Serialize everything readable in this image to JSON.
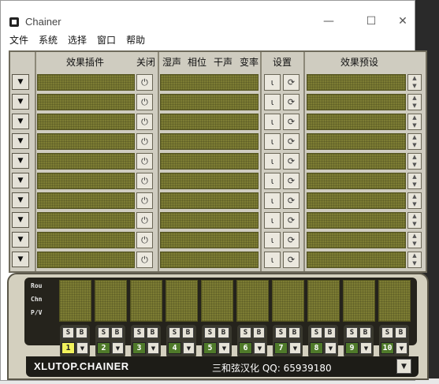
{
  "window": {
    "title": "Chainer",
    "min_glyph": "—",
    "max_glyph": "☐",
    "close_glyph": "✕"
  },
  "menu": [
    "文件",
    "系统",
    "选择",
    "窗口",
    "帮助"
  ],
  "header": {
    "plugin": "效果插件",
    "bypass": "关闭",
    "wet": "湿声",
    "phase": "相位",
    "dry": "干声",
    "rate": "变率",
    "settings": "设置",
    "preset": "效果预设"
  },
  "rows": 10,
  "glyphs": {
    "slot": "▼",
    "power": "⏻",
    "set1": "⍳",
    "set2": "⟳",
    "up": "▲",
    "down": "▼"
  },
  "mixer": {
    "labels": [
      "Rou",
      "Chn",
      "P/V"
    ],
    "btn_s": "S",
    "btn_b": "B",
    "channels": [
      "1",
      "2",
      "3",
      "4",
      "5",
      "6",
      "7",
      "8",
      "9",
      "10"
    ],
    "active_channel": "1"
  },
  "footer": {
    "brand": "Xlutop.Chainer",
    "credit": "三和弦汉化 QQ: 65939180"
  },
  "colors": {
    "lcd": "#7c7c33",
    "panel": "#cfccc0",
    "dark": "#25231c",
    "active": "#f2f25c",
    "channel": "#4f7a2a"
  }
}
